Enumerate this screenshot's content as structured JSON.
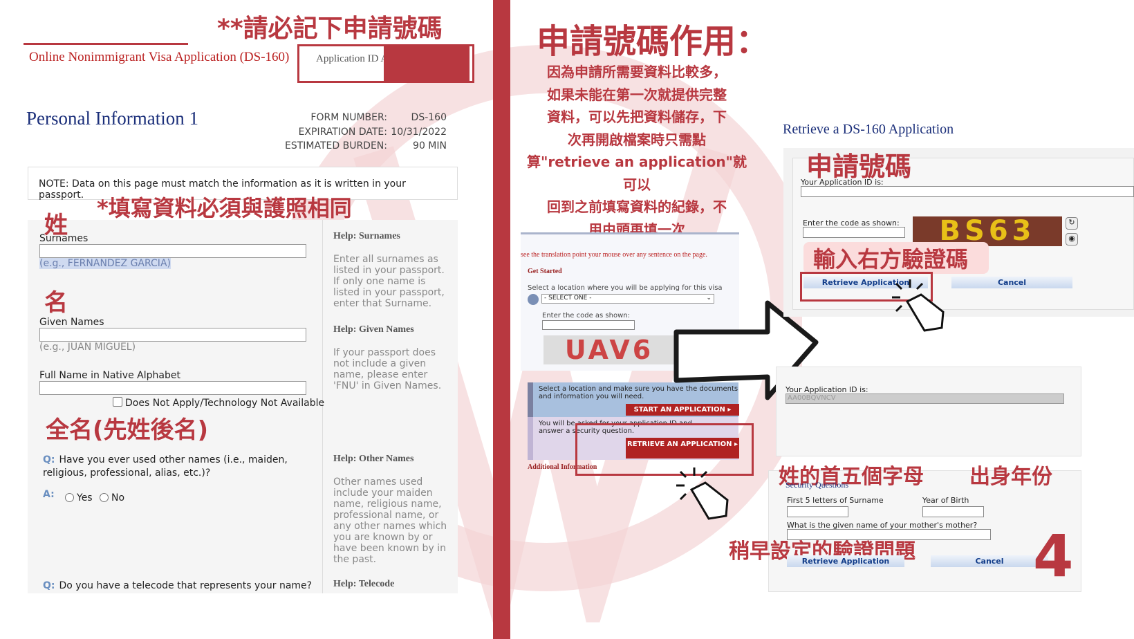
{
  "left": {
    "note_top": "**請必記下申請號碼",
    "app_title": "Online Nonimmigrant Visa Application (DS-160)",
    "app_id_label": "Application ID A",
    "page_title": "Personal Information 1",
    "form_number_label": "FORM NUMBER:",
    "form_number": "DS-160",
    "expiration_label": "EXPIRATION DATE:",
    "expiration": "10/31/2022",
    "burden_label": "ESTIMATED BURDEN:",
    "burden": "90 MIN",
    "note": "NOTE: Data on this page must match the information as it is written in your passport.",
    "ann_match": "*填寫資料必須與護照相同",
    "ann_surname": "姓",
    "ann_given": "名",
    "ann_full": "全名(先姓後名)",
    "surnames_label": "Surnames",
    "surnames_example": "(e.g., FERNANDEZ GARCIA)",
    "given_label": "Given Names",
    "given_example": "(e.g., JUAN MIGUEL)",
    "native_label": "Full Name in Native Alphabet",
    "does_not_apply": "Does Not Apply/Technology Not Available",
    "q_other": "Have you ever used other names (i.e., maiden, religious, professional, alias, etc.)?",
    "q_mark": "Q:",
    "a_mark": "A:",
    "yes": "Yes",
    "no": "No",
    "q_telecode": "Do you have a telecode that represents your name?",
    "help_prefix": "Help:",
    "help": [
      {
        "title": "Surnames",
        "text": "Enter all surnames as listed in your passport. If only one name is listed in your passport, enter that Surname."
      },
      {
        "title": "Given Names",
        "text": "If your passport does not include a given name, please enter 'FNU' in Given Names."
      },
      {
        "title": "Other Names",
        "text": "Other names used include your maiden name, religious name, professional name, or any other names which you are known by or have been known by in the past."
      },
      {
        "title": "Telecode",
        "text": ""
      }
    ]
  },
  "middle": {
    "heading": "申請號碼作用：",
    "lines": [
      "因為申請所需要資料比較多，",
      "如果未能在第一次就提供完整",
      "資料，可以先把資料儲存，下",
      "次再開啟檔案時只需點",
      "算\"retrieve an application\"就可以",
      "回到之前填寫資料的紀錄，不",
      "用由頭再填一次"
    ],
    "translation_tip": "see the translation point your mouse over any sentence on the page.",
    "get_started": "Get Started",
    "select_location": "Select a location where you will be applying for this visa",
    "select_value": "- SELECT ONE -",
    "enter_code": "Enter the code as shown:",
    "captcha": "UAV6",
    "start_text": "Select a location and make sure you have the documents and information you will need.",
    "start_btn": "START AN APPLICATION",
    "retrieve_text": "You will be asked for your application ID and answer a security question.",
    "retrieve_btn": "RETRIEVE AN APPLICATION",
    "additional": "Additional Information"
  },
  "right": {
    "title": "Retrieve a DS-160 Application",
    "ann_id": "申請號碼",
    "your_id": "Your Application ID is:",
    "enter_code": "Enter the code as shown:",
    "captcha": "BS63",
    "ann_captcha": "輸入右方驗證碼",
    "retrieve_btn": "Retrieve Application",
    "cancel_btn": "Cancel",
    "your_id2": "Your Application ID is:",
    "id_value": "AA00BQVNCV",
    "ann_surname5": "姓的首五個字母",
    "ann_birth": "出身年份",
    "security_title": "Security Questions",
    "first5": "First 5 letters of Surname",
    "yob": "Year of Birth",
    "mother_q": "What is the given name of your mother's mother?",
    "ann_security": "稍早設定的驗證問題",
    "page_number": "4"
  },
  "colors": {
    "accent": "#b83840",
    "link_blue": "#1b2f7a"
  }
}
